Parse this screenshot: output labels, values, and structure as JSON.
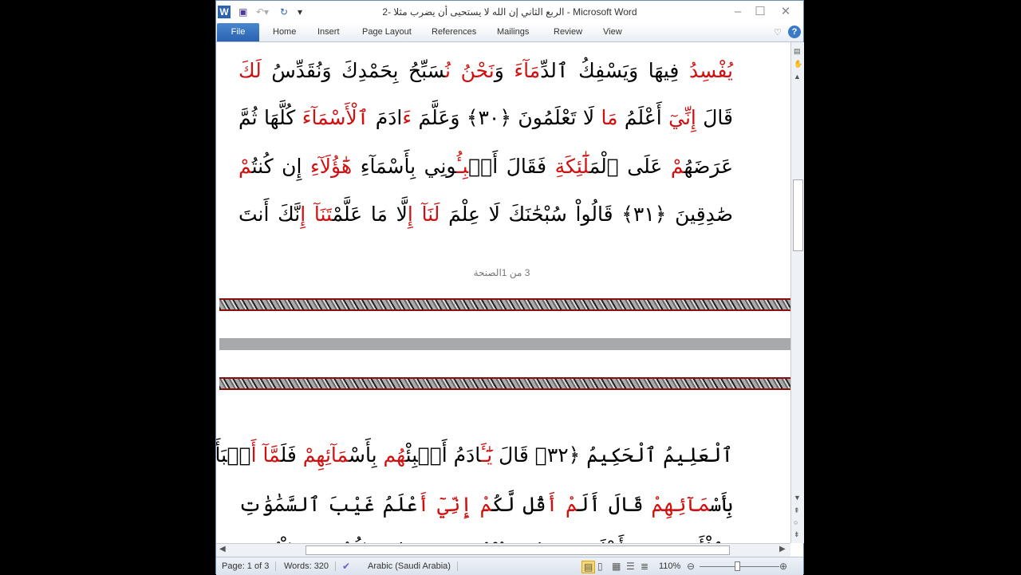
{
  "window": {
    "title": "الربع الثاني إن الله لا يستحيى أن يضرب مثلا -2  -  Microsoft Word"
  },
  "ribbon": {
    "file": "File",
    "tabs": [
      "Home",
      "Insert",
      "Page Layout",
      "References",
      "Mailings",
      "Review",
      "View"
    ]
  },
  "page1": {
    "lines": [
      [
        {
          "t": "يُفْسِدُ",
          "r": true
        },
        {
          "t": " فِيهَا وَيَسْفِكُ ٱلدِّ"
        },
        {
          "t": "مَآءَ",
          "r": true
        },
        {
          "t": " وَ"
        },
        {
          "t": "نَحْنُ نُ",
          "r": true
        },
        {
          "t": "سَبِّحُ بِحَمْدِكَ وَنُقَدِّسُ "
        },
        {
          "t": "لَكَ",
          "r": true
        }
      ],
      [
        {
          "t": "قَالَ "
        },
        {
          "t": "إِنِّيٓ",
          "r": true
        },
        {
          "t": " أَعْلَمُ "
        },
        {
          "t": "مَا",
          "r": true
        },
        {
          "t": " لَا تَعْلَمُونَ ﴿٣٠﴾ وَعَلَّمَ "
        },
        {
          "t": "ءَ",
          "r": true
        },
        {
          "t": "ادَمَ "
        },
        {
          "t": "ٱلْأَسْمَآءَ",
          "r": true
        },
        {
          "t": " كُلَّهَا ثُمَّ"
        }
      ],
      [
        {
          "t": "عَرَضَهُ"
        },
        {
          "t": "مْ",
          "r": true
        },
        {
          "t": " عَلَى ٱلْمَ"
        },
        {
          "t": "لَٰٓئِكَةِ",
          "r": true
        },
        {
          "t": " فَقَالَ أَنۢ"
        },
        {
          "t": "بِـُٔ",
          "r": true
        },
        {
          "t": "ونِي بِأَسْمَآءِ "
        },
        {
          "t": "هَٰٓؤُلَآءِ",
          "r": true
        },
        {
          "t": " إِن كُنتُ"
        },
        {
          "t": "مْ",
          "r": true
        }
      ],
      [
        {
          "t": "صَٰدِقِينَ ﴿٣١﴾ قَالُواْ سُبْحَٰنَكَ لَا عِلْمَ "
        },
        {
          "t": "لَنَآ",
          "r": true
        },
        {
          "t": " "
        },
        {
          "t": "إِ",
          "r": true
        },
        {
          "t": "لَّا مَا عَلَّمْ"
        },
        {
          "t": "تَنَآ",
          "r": true
        },
        {
          "t": " "
        },
        {
          "t": "إِ",
          "r": true
        },
        {
          "t": "نَّكَ أَنتَ"
        }
      ]
    ],
    "footer": "3 من 1الصنحة"
  },
  "page2": {
    "lines": [
      [
        {
          "t": "ٱلْعَلِيمُ ٱلْحَكِيمُ ﴿٣٢﴾ قَالَ "
        },
        {
          "t": "يَٰٓـَٔ",
          "r": true
        },
        {
          "t": "ادَمُ أَنۢبِئْ"
        },
        {
          "t": "هُم",
          "r": true
        },
        {
          "t": " بِأَسْ"
        },
        {
          "t": "مَآئِهِمْ",
          "r": true
        },
        {
          "t": " فَلَ"
        },
        {
          "t": "مَّآ أَ",
          "r": true
        },
        {
          "t": "نۢبَأَهُ"
        },
        {
          "t": "م",
          "r": true
        }
      ],
      [
        {
          "t": "بِأَسْ"
        },
        {
          "t": "مَآئِهِمْ",
          "r": true
        },
        {
          "t": " قَالَ أَلَ"
        },
        {
          "t": "مْ أَ",
          "r": true
        },
        {
          "t": "قُل لَّكُ"
        },
        {
          "t": "مْ إِنِّيٓ أَ",
          "r": true
        },
        {
          "t": "عْلَمُ غَيْبَ ٱلسَّمَٰوَٰتِ"
        }
      ],
      [
        {
          "t": "وَٱلْأَرْضِ وَأَعْلَمُ مَا تُبْدُونَ وَمَا كُنتُمْ تَكْتُمُونَ"
        }
      ]
    ]
  },
  "status": {
    "page": "Page: 1 of 3",
    "words": "Words: 320",
    "language": "Arabic (Saudi Arabia)",
    "zoom": "110%"
  },
  "colors": {
    "accent": "#2a62b0",
    "quran_red": "#d01010"
  }
}
